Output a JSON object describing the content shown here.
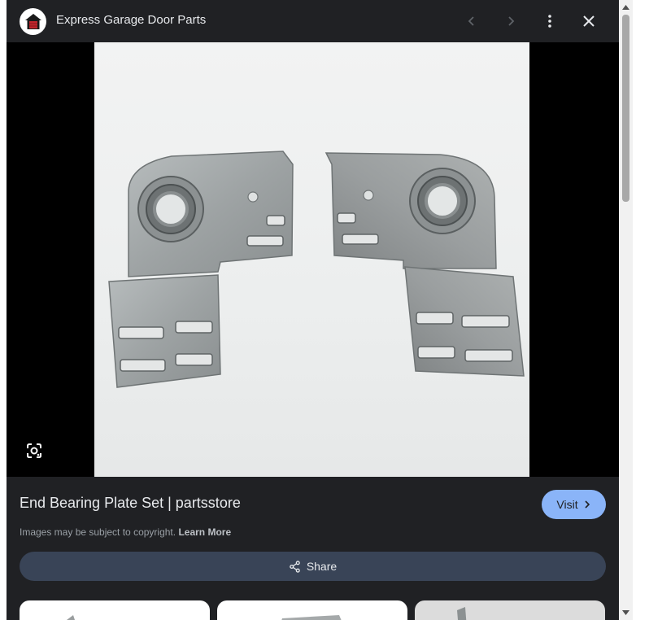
{
  "header": {
    "site_name": "Express Garage Door Parts",
    "logo_icon": "garage-house-icon",
    "prev_icon": "chevron-left-icon",
    "next_icon": "chevron-right-icon",
    "menu_icon": "more-vertical-icon",
    "close_icon": "close-icon"
  },
  "viewer": {
    "image_subject": "end-bearing-plate-set-photo",
    "lens_icon": "google-lens-icon"
  },
  "info": {
    "title": "End Bearing Plate Set | partsstore",
    "visit_label": "Visit",
    "copyright_text": "Images may be subject to copyright.",
    "learn_more_label": "Learn More",
    "share_label": "Share"
  },
  "colors": {
    "panel_bg": "#202124",
    "accent": "#8ab4f8",
    "share_bg": "#394457",
    "text_primary": "#e8eaed",
    "text_secondary": "#9aa0a6"
  }
}
